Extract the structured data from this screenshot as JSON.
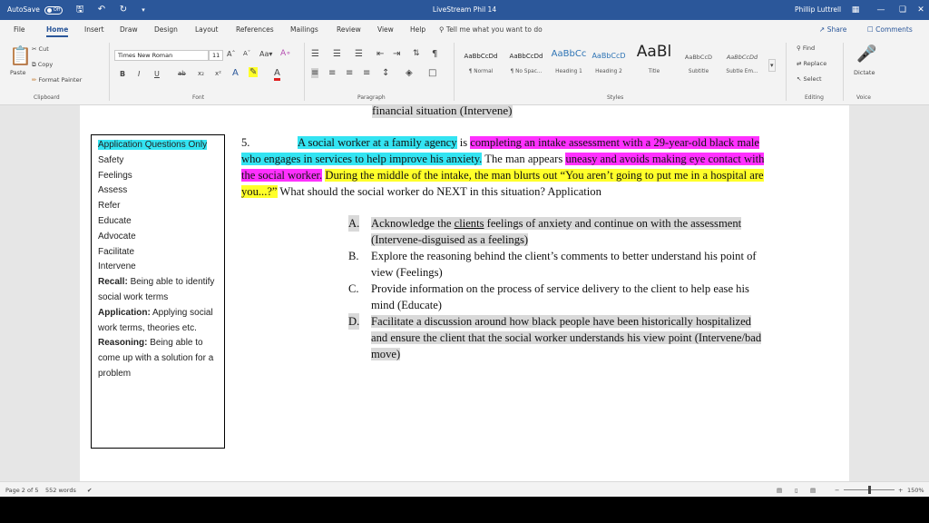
{
  "titlebar": {
    "autosave_label": "AutoSave",
    "autosave_state": "Off",
    "title": "LiveStream Phil 14",
    "user": "Phillip Luttrell",
    "minimize": "—",
    "restore": "❏",
    "close": "✕"
  },
  "tabs": [
    "File",
    "Home",
    "Insert",
    "Draw",
    "Design",
    "Layout",
    "References",
    "Mailings",
    "Review",
    "View",
    "Help"
  ],
  "tell_me": "Tell me what you want to do",
  "share": "Share",
  "comments": "Comments",
  "ribbon": {
    "clipboard": {
      "paste": "Paste",
      "cut": "Cut",
      "copy": "Copy",
      "format_painter": "Format Painter",
      "label": "Clipboard"
    },
    "font": {
      "name": "Times New Roman",
      "size": "11",
      "label": "Font",
      "bold": "B",
      "italic": "I",
      "underline": "U",
      "strike": "ab",
      "sub": "x₂",
      "sup": "x²"
    },
    "paragraph": {
      "label": "Paragraph"
    },
    "styles": {
      "label": "Styles",
      "items": [
        {
          "preview": "AaBbCcDd",
          "name": "¶ Normal"
        },
        {
          "preview": "AaBbCcDd",
          "name": "¶ No Spac..."
        },
        {
          "preview": "AaBbCc",
          "name": "Heading 1"
        },
        {
          "preview": "AaBbCcD",
          "name": "Heading 2"
        },
        {
          "preview": "AaBl",
          "name": "Title"
        },
        {
          "preview": "AaBbCcD",
          "name": "Subtitle"
        },
        {
          "preview": "AaBbCcDd",
          "name": "Subtle Em..."
        }
      ]
    },
    "editing": {
      "find": "Find",
      "replace": "Replace",
      "select": "Select",
      "label": "Editing"
    },
    "voice": {
      "dictate": "Dictate",
      "label": "Voice"
    }
  },
  "document": {
    "prev_line": "financial situation (Intervene)",
    "sidebox": {
      "title": "Application Questions Only",
      "items": [
        "Safety",
        "Feelings",
        "Assess",
        "Refer",
        "Educate",
        "Advocate",
        "Facilitate",
        "Intervene"
      ],
      "recall_label": "Recall:",
      "recall_text": " Being able to identify social work terms",
      "application_label": "Application:",
      "application_text": " Applying social work terms, theories etc.",
      "reasoning_label": "Reasoning:",
      "reasoning_text": " Being able to come up with a solution for a problem"
    },
    "question": {
      "number": "5.",
      "part1": "A social worker at a family agency",
      "part2": " is ",
      "part3": "completing an intake assessment with a 29-year-old black male",
      "part4": " ",
      "part5": "who engages in services to help improve his anxiety.",
      "part6": " The man appears ",
      "part7": "uneasy and avoids making eye contact with the social worker.",
      "part8": " ",
      "part9": "During the middle of the intake, the man blurts out “You aren’t going to put me in a hospital are you...?”",
      "part10": " What should the social worker do NEXT in this situation?  Application"
    },
    "answers": [
      {
        "letter": "A.",
        "pre": "Acknowledge the ",
        "u": "clients",
        "post": " feelings of anxiety and continue on with the assessment (Intervene-disguised as a feelings)"
      },
      {
        "letter": "B.",
        "pre": "Explore the reasoning behind the client’s comments to better understand his point of view (Feelings)",
        "u": "",
        "post": ""
      },
      {
        "letter": "C.",
        "pre": "Provide information on the process of service delivery to the client to help ease his mind (Educate)",
        "u": "",
        "post": ""
      },
      {
        "letter": "D.",
        "pre": "Facilitate a discussion around how black people have been historically hospitalized  and ensure the client that the social worker understands his view point (Intervene/bad move)",
        "u": "",
        "post": ""
      }
    ]
  },
  "status": {
    "page": "Page 2 of 5",
    "words": "552 words",
    "zoom": "150%"
  },
  "colors": {
    "accent": "#2b579a",
    "highlight_cyan": "#33e4f2",
    "highlight_magenta": "#ff30ff",
    "highlight_yellow": "#ffff2a",
    "highlight_gray": "#d9d9d9"
  }
}
